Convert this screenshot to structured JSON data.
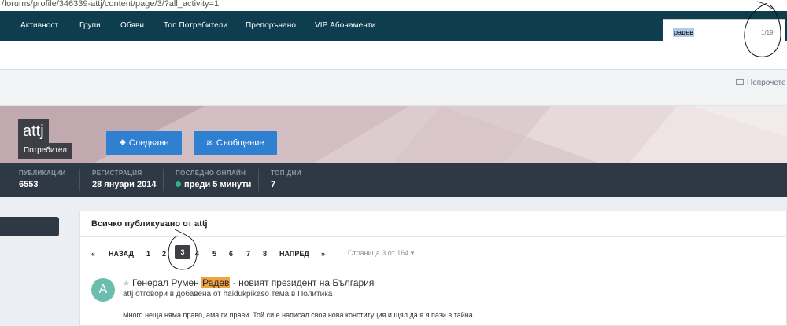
{
  "url": "/forums/profile/346339-attj/content/page/3/?all_activity=1",
  "nav": {
    "items": [
      "Активност",
      "Групи",
      "Обяви",
      "Топ Потребители",
      "Препоръчано",
      "VIP Абонаменти"
    ]
  },
  "find": {
    "query": "радев",
    "count": "1/19"
  },
  "unread": "Непрочете",
  "profile": {
    "name": "attj",
    "role": "Потребител",
    "follow_label": "Следване",
    "message_label": "Съобщение"
  },
  "stats": [
    {
      "label": "ПУБЛИКАЦИИ",
      "value": "6553"
    },
    {
      "label": "РЕГИСТРАЦИЯ",
      "value": "28 януари 2014"
    },
    {
      "label": "ПОСЛЕДНО ОНЛАЙН",
      "value": "преди 5 минути"
    },
    {
      "label": "ТОП ДНИ",
      "value": "7"
    }
  ],
  "content": {
    "title": "Всичко публикувано от attj",
    "pager": {
      "first": "«",
      "prev": "НАЗАД",
      "pages": [
        "1",
        "2",
        "3",
        "4",
        "5",
        "6",
        "7",
        "8"
      ],
      "current": "3",
      "next": "НАПРЕД",
      "last": "»",
      "info": "Страница 3 от 164"
    },
    "post": {
      "avatar_letter": "A",
      "title_before": "Генерал Румен ",
      "title_highlight": "Радев",
      "title_after": " - новият президент на България",
      "meta": "attj отговори в добавена от haidukpikaso тема в Политика",
      "body": "Много неща няма право, ама ги прави. Той си е написал своя нова конституция и щял да я я пази в тайна."
    }
  },
  "colors": {
    "navbar": "#0d3d4e",
    "button": "#2f80d1",
    "stats_bar": "#2f3845",
    "highlight": "#f0a343",
    "avatar": "#6cbdae",
    "online": "#2eb67d"
  }
}
